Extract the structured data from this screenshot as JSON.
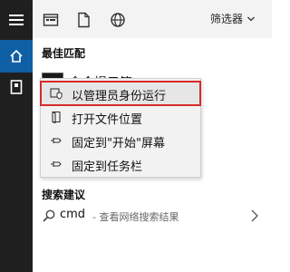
{
  "toolbar": {
    "filter_label": "筛选器"
  },
  "best_match": {
    "title": "最佳匹配",
    "app_name": "命令提示符",
    "app_subtitle": "rompt"
  },
  "context_menu": [
    {
      "label": "以管理员身份运行",
      "icon": "shield-icon",
      "highlighted": true
    },
    {
      "label": "打开文件位置",
      "icon": "folder-open-icon",
      "highlighted": false
    },
    {
      "label": "固定到\"开始\"屏幕",
      "icon": "pin-icon",
      "highlighted": false
    },
    {
      "label": "固定到任务栏",
      "icon": "pin-icon",
      "highlighted": false
    }
  ],
  "search_suggestions": {
    "title": "搜索建议",
    "items": [
      {
        "query": "cmd",
        "hint": "- 查看网络搜索结果"
      }
    ]
  },
  "colors": {
    "rail_bg": "#1f1f1f",
    "rail_active": "#0f5fa5",
    "highlight_outline": "#d62b2b"
  }
}
